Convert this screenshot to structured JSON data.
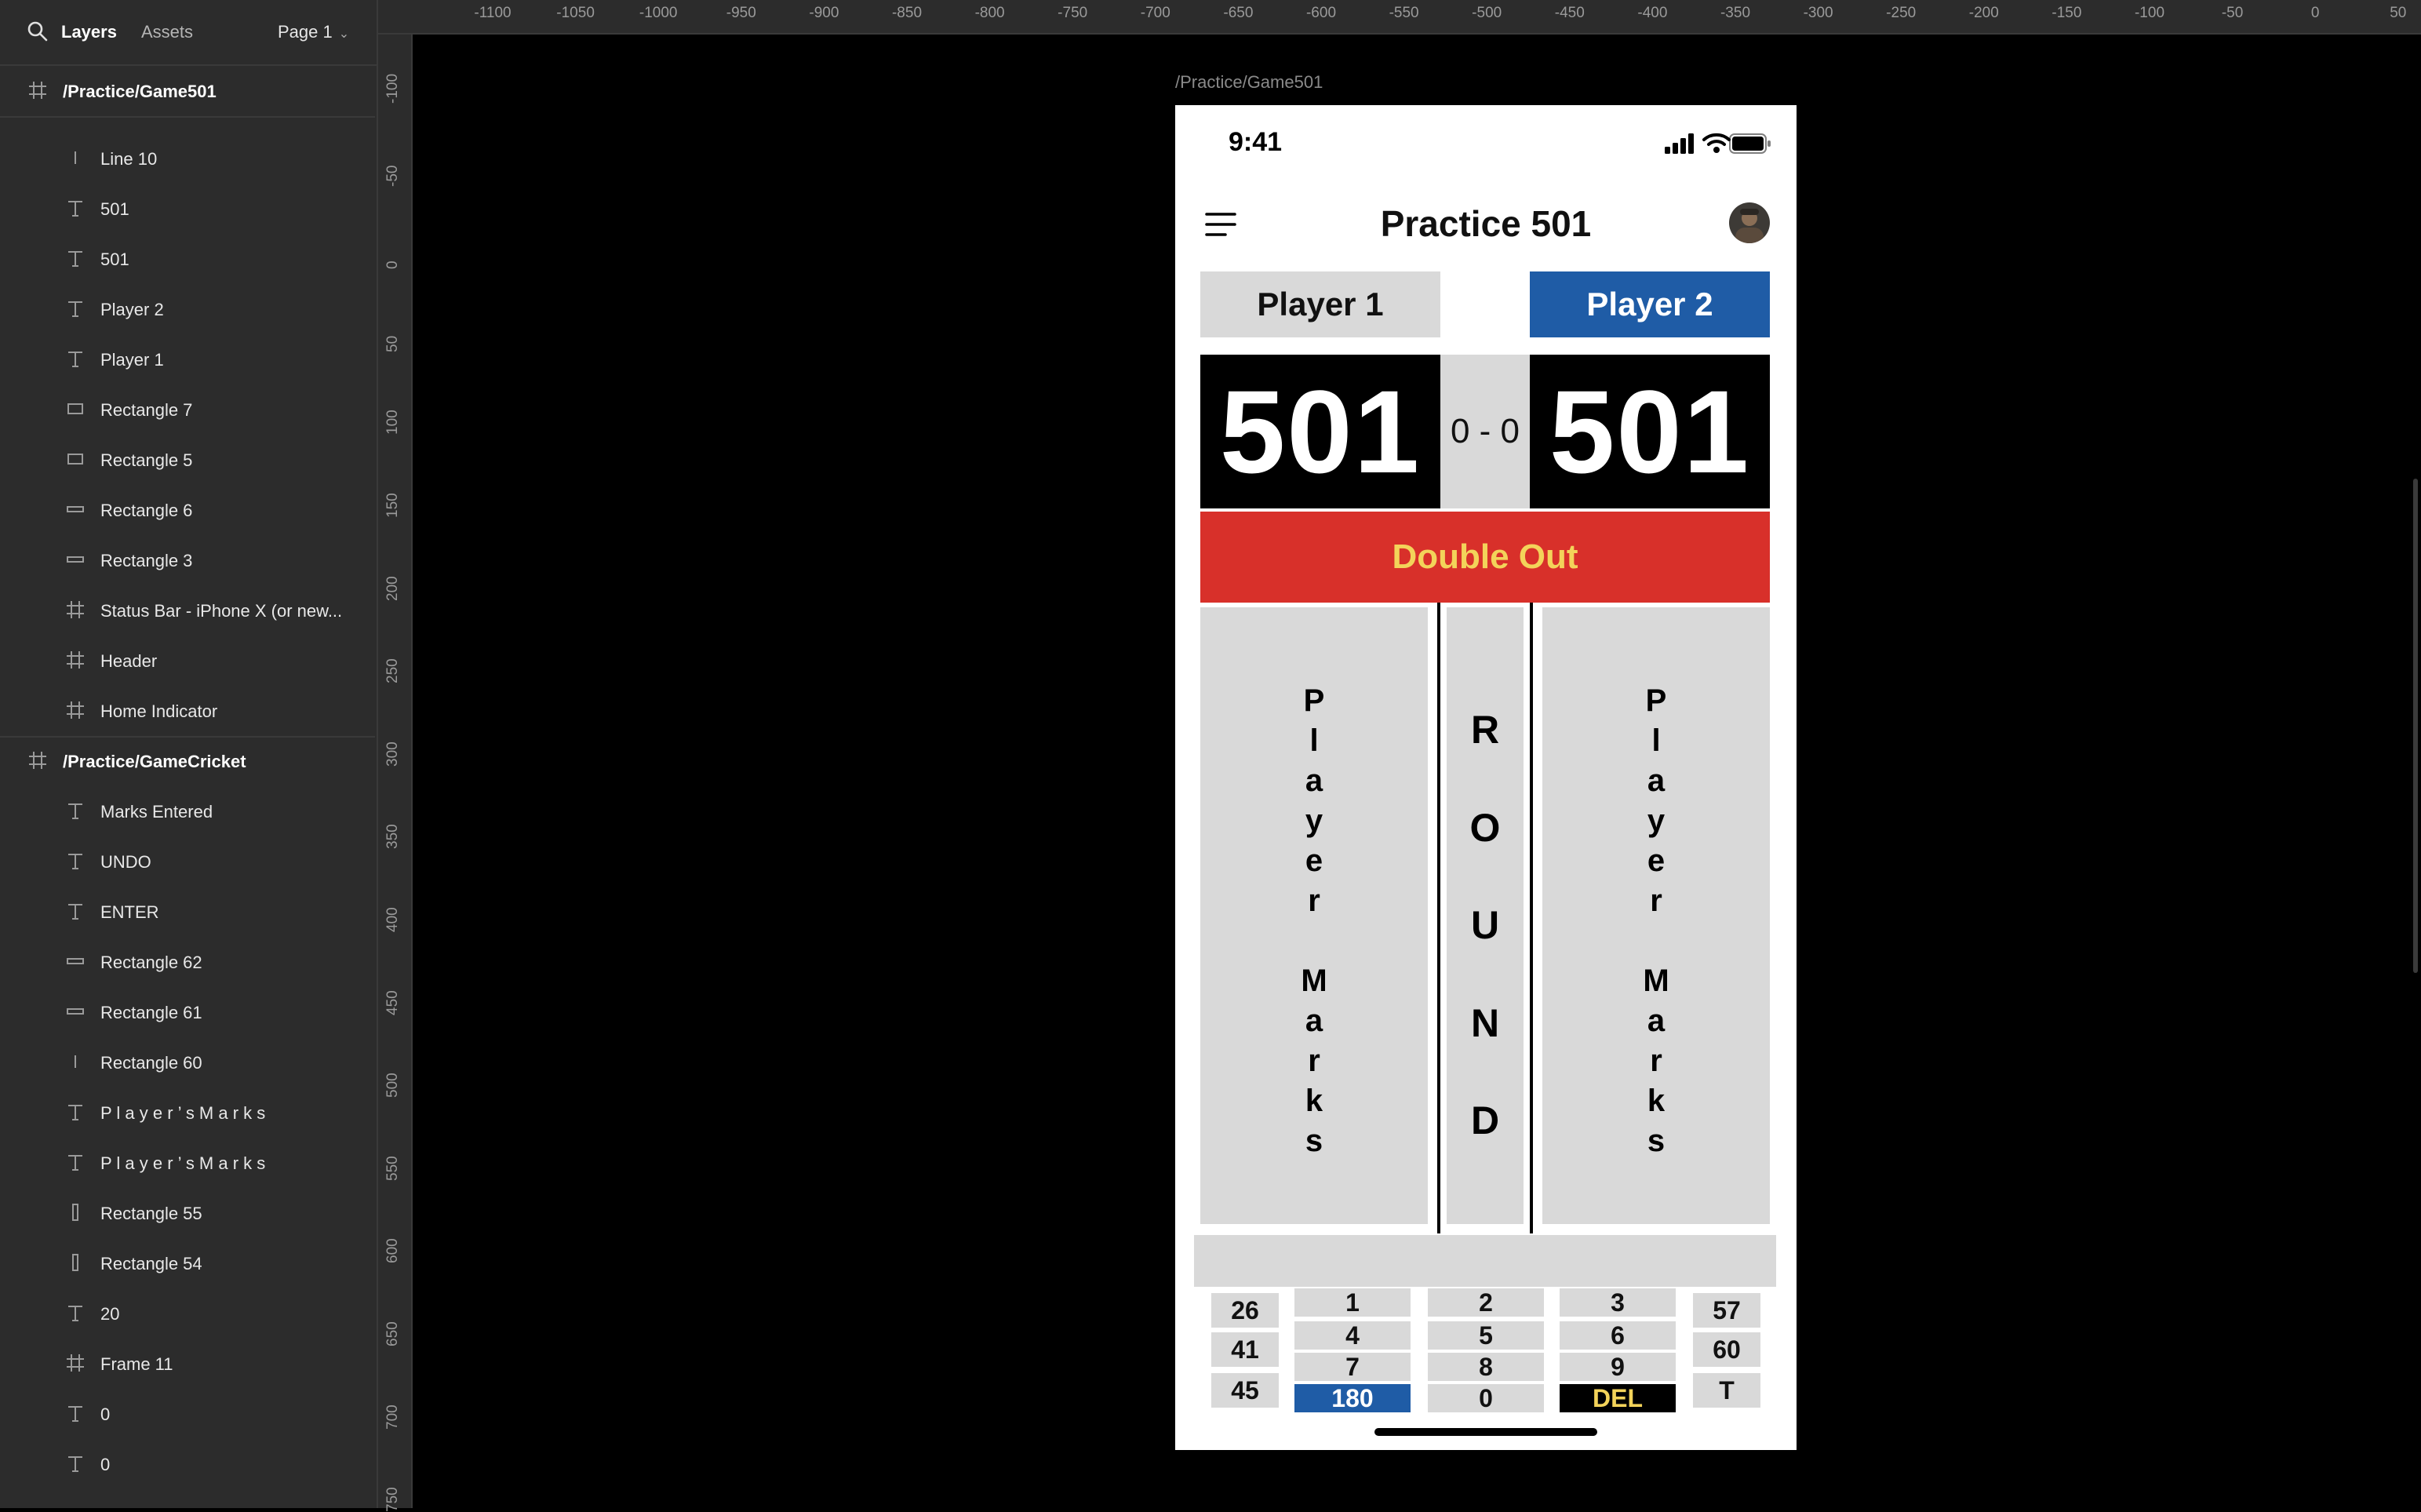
{
  "left_panel": {
    "tabs": {
      "layers": "Layers",
      "assets": "Assets"
    },
    "page_select": "Page 1",
    "layers": [
      {
        "name": "/Practice/Game501",
        "kind": "frame"
      },
      {
        "name": "Line 10",
        "kind": "line"
      },
      {
        "name": "501",
        "kind": "text"
      },
      {
        "name": "501",
        "kind": "text"
      },
      {
        "name": "Player 2",
        "kind": "text"
      },
      {
        "name": "Player 1",
        "kind": "text"
      },
      {
        "name": "Rectangle 7",
        "kind": "rect"
      },
      {
        "name": "Rectangle 5",
        "kind": "rect"
      },
      {
        "name": "Rectangle 6",
        "kind": "thin-rect"
      },
      {
        "name": "Rectangle 3",
        "kind": "thin-rect"
      },
      {
        "name": "Status Bar - iPhone X (or new...",
        "kind": "frame"
      },
      {
        "name": "Header",
        "kind": "frame"
      },
      {
        "name": "Home Indicator",
        "kind": "frame"
      },
      {
        "name": "/Practice/GameCricket",
        "kind": "frame"
      },
      {
        "name": "Marks Entered",
        "kind": "text"
      },
      {
        "name": "UNDO",
        "kind": "text"
      },
      {
        "name": "ENTER",
        "kind": "text"
      },
      {
        "name": "Rectangle 62",
        "kind": "thin-rect"
      },
      {
        "name": "Rectangle 61",
        "kind": "thin-rect"
      },
      {
        "name": "Rectangle 60",
        "kind": "line"
      },
      {
        "name": "P l a y e r ’ s M a r k s",
        "kind": "text"
      },
      {
        "name": "P l a y e r ’ s M a r k s",
        "kind": "text"
      },
      {
        "name": "Rectangle 55",
        "kind": "tall-rect"
      },
      {
        "name": "Rectangle 54",
        "kind": "tall-rect"
      },
      {
        "name": "20",
        "kind": "text"
      },
      {
        "name": "Frame 11",
        "kind": "frame"
      },
      {
        "name": "0",
        "kind": "text"
      },
      {
        "name": "0",
        "kind": "text"
      }
    ]
  },
  "rulers": {
    "top": [
      "-1100",
      "-1050",
      "-1000",
      "-950",
      "-900",
      "-850",
      "-800",
      "-750",
      "-700",
      "-650",
      "-600",
      "-550",
      "-500",
      "-450",
      "-400",
      "-350",
      "-300",
      "-250",
      "-200",
      "-150",
      "-100",
      "-50",
      "0",
      "50"
    ],
    "left": [
      "-100",
      "-50",
      "0",
      "50",
      "100",
      "150",
      "200",
      "250",
      "300",
      "350",
      "400",
      "450",
      "500",
      "550",
      "600",
      "650",
      "700",
      "750"
    ]
  },
  "canvas": {
    "frame_label": "/Practice/Game501",
    "status_bar": {
      "time": "9:41"
    },
    "app": {
      "title": "Practice 501",
      "player1_label": "Player 1",
      "player2_label": "Player 2",
      "player1_score": "501",
      "player2_score": "501",
      "round_score": "0 - 0",
      "out_mode": "Double Out",
      "player_marks_letters": [
        "P",
        "l",
        "a",
        "y",
        "e",
        "r",
        "",
        "M",
        "a",
        "r",
        "k",
        "s"
      ],
      "round_letters": [
        "R",
        "O",
        "U",
        "N",
        "D"
      ],
      "keypad": {
        "left_column": [
          "26",
          "41",
          "45"
        ],
        "right_column": [
          "57",
          "60",
          "T"
        ],
        "grid": [
          [
            "1",
            "2",
            "3"
          ],
          [
            "4",
            "5",
            "6"
          ],
          [
            "7",
            "8",
            "9"
          ],
          [
            "180",
            "0",
            "DEL"
          ]
        ]
      }
    }
  },
  "colors": {
    "player2_blue": "#1f5ca6",
    "banner_red": "#d8302a",
    "banner_text_yellow": "#f3d35a",
    "panel_gray": "#d9d9d9"
  }
}
